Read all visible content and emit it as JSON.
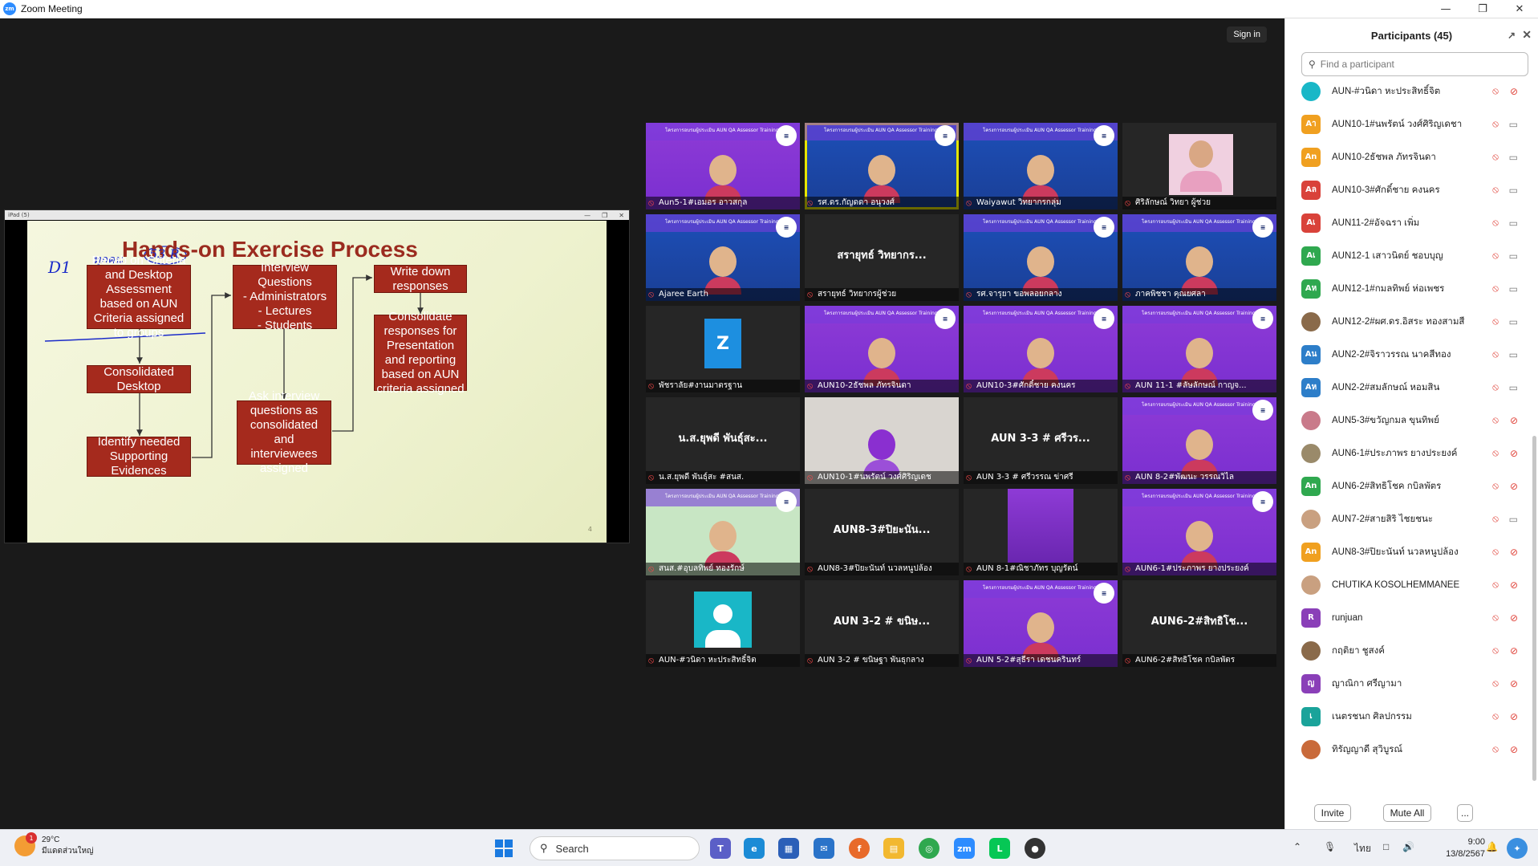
{
  "window": {
    "title": "Zoom Meeting",
    "logo": "zm"
  },
  "header": {
    "signin_label": "Sign in"
  },
  "share": {
    "window_title": "iPad (5)",
    "slide_title": "Hands-on Exercise Process",
    "boxes": [
      "Recab on Criteria and Desktop Assessment based on  AUN Criteria assigned to groups",
      "Interview Questions\n- Administrators\n-    Lectures\n-    Students",
      "Write down responses",
      "Consolidated Desktop",
      "Consolidate responses for Presentation and reporting based on AUN criteria assigned",
      "Ask interview questions as consolidated and interviewees assigned",
      "Identify needed Supporting Evidences"
    ],
    "ink_notes": {
      "d1": "D1",
      "group": "ทุกคน",
      "room": "53 R"
    },
    "page_number": "4"
  },
  "video_tiles": [
    {
      "label": "Aun5-1#เอมอร อาวสกุล",
      "style": "purple",
      "banner": "โครงการอบรมผู้ประเมิน AUN QA Assessor Training"
    },
    {
      "label": "รศ.ดร.กัญดดา อนุวงศ์",
      "style": "blue",
      "active": true,
      "banner": "โครงการอบรมผู้ประเมิน AUN QA Assessor Training"
    },
    {
      "label": "Waiyawut วิทยากรกลุ่ม",
      "style": "blue",
      "banner": "โครงการอบรมผู้ประเมิน AUN QA Assessor Training"
    },
    {
      "label": "ศิริลักษณ์ วิทยา ผู้ช่วย",
      "style": "dark"
    },
    {
      "label": "Ajaree  Earth",
      "style": "blue",
      "banner": "โครงการอบรมผู้ประเมิน AUN QA Assessor Training"
    },
    {
      "label": "สรายุทธ์ วิทยากรผู้ช่วย",
      "style": "name",
      "name": "สรายุทธ์ วิทยากร..."
    },
    {
      "label": "รศ.จารุยา ขอพลอยกลาง",
      "style": "blue",
      "banner": "โครงการอบรมผู้ประเมิน AUN QA Assessor Training"
    },
    {
      "label": "ภาคพิชชา คุณยศลา",
      "style": "blue",
      "banner": "โครงการอบรมผู้ประเมิน AUN QA Assessor Training"
    },
    {
      "label": "พัชราลัย#งานมาตรฐาน",
      "style": "avatar-z",
      "avatar": "Z"
    },
    {
      "label": "AUN10-2ธัชพล ภัทรจินดา",
      "style": "purple",
      "banner": "โครงการอบรมผู้ประเมิน AUN QA Assessor Training"
    },
    {
      "label": "AUN10-3#ศักดิ์ชาย คงนคร",
      "style": "purple",
      "banner": "โครงการอบรมผู้ประเมิน AUN QA Assessor Training"
    },
    {
      "label": "AUN 11-1 #ลัษลักษณ์ กาญจ...",
      "style": "purple",
      "banner": "โครงการอบรมผู้ประเมิน AUN QA Assessor Training"
    },
    {
      "label": "น.ส.ยุพดี พันธุ์สะ #สนส.",
      "style": "name",
      "name": "น.ส.ยุพดี พันธุ์สะ..."
    },
    {
      "label": "AUN10-1#นพรัตน์ วงศ์ศิริญเดช",
      "style": "light"
    },
    {
      "label": "AUN 3-3 # ศรีวรรณ ข่าศรี",
      "style": "name",
      "name": "AUN 3-3 # ศรีวร..."
    },
    {
      "label": "AUN 8-2#พัฒนะ วรรณวิไล",
      "style": "purple",
      "banner": "โครงการอบรมผู้ประเมิน AUN QA Assessor Training"
    },
    {
      "label": "สนส.#อุบลทิพย์ ทองรักษ์",
      "style": "green",
      "banner": "โครงการอบรมผู้ประเมิน AUN QA Assessor Training"
    },
    {
      "label": "AUN8-3#ปิยะนันท์ นวลหนูปล้อง",
      "style": "name",
      "name": "AUN8-3#ปิยะนัน..."
    },
    {
      "label": "AUN 8-1#ณิชาภัทร บุญรัตน์",
      "style": "dark-purple"
    },
    {
      "label": "AUN6-1#ประภาพร ยางประยงค์",
      "style": "purple",
      "banner": "โครงการอบรมผู้ประเมิน AUN QA Assessor Training"
    },
    {
      "label": "AUN-#วนิดา หะประสิทธิ์จิต",
      "style": "avatar-person"
    },
    {
      "label": "AUN 3-2 # ขนิษฐา พันธุกลาง",
      "style": "name",
      "name": "AUN 3-2 # ขนิษ..."
    },
    {
      "label": "AUN 5-2#สุธีรา เดชนครินทร์",
      "style": "purple",
      "banner": "โครงการอบรมผู้ประเมิน AUN QA Assessor Training"
    },
    {
      "label": "AUN6-2#สิทธิโชค กบิลพัตร",
      "style": "name",
      "name": "AUN6-2#สิทธิโช..."
    }
  ],
  "participants": {
    "title": "Participants (45)",
    "search_placeholder": "Find a participant",
    "list": [
      {
        "initials": "",
        "name": "AUN-#วนิดา หะประสิทธิ์จิต",
        "color": "#19b7c7",
        "camera": "off"
      },
      {
        "initials": "Aา",
        "name": "AUN10-1#นพรัตน์ วงศ์ศิริญเดชา",
        "color": "#f0a020",
        "camera": "on"
      },
      {
        "initials": "An",
        "name": "AUN10-2ธัชพล ภัทรจินดา",
        "color": "#f0a020",
        "camera": "on"
      },
      {
        "initials": "Aล",
        "name": "AUN10-3#ศักดิ์ชาย คงนคร",
        "color": "#d9423a",
        "camera": "on"
      },
      {
        "initials": "Aเ",
        "name": "AUN11-2#อัจฉรา เพิ่ม",
        "color": "#d9423a",
        "camera": "on"
      },
      {
        "initials": "Aเ",
        "name": "AUN12-1 เสาวนิตย์ ชอบบุญ",
        "color": "#2fa84f",
        "camera": "on"
      },
      {
        "initials": "Aห",
        "name": "AUN12-1#กมลทิพย์ ห่อเพชร",
        "color": "#2fa84f",
        "camera": "on"
      },
      {
        "initials": "",
        "name": "AUN12-2#ผศ.ดร.อิสระ ทองสามสี",
        "color": "#8a6a4a",
        "camera": "on"
      },
      {
        "initials": "Aน",
        "name": "AUN2-2#จิราวรรณ นาคสีทอง",
        "color": "#2d7ec9",
        "camera": "on"
      },
      {
        "initials": "Aห",
        "name": "AUN2-2#สมลักษณ์ หอมสิน",
        "color": "#2d7ec9",
        "camera": "on"
      },
      {
        "initials": "",
        "name": "AUN5-3#ขวัญกมล ขุนทิพย์",
        "color": "#c97a8a",
        "camera": "off"
      },
      {
        "initials": "",
        "name": "AUN6-1#ประภาพร ยางประยงค์",
        "color": "#9a8a6a",
        "camera": "off"
      },
      {
        "initials": "An",
        "name": "AUN6-2#สิทธิโชค กบิลพัตร",
        "color": "#2fa84f",
        "camera": "off"
      },
      {
        "initials": "",
        "name": "AUN7-2#สายสิริ ไชยชนะ",
        "color": "#c9a080",
        "camera": "on"
      },
      {
        "initials": "An",
        "name": "AUN8-3#ปิยะนันท์ นวลหนูปล้อง",
        "color": "#f0a020",
        "camera": "off"
      },
      {
        "initials": "",
        "name": "CHUTIKA KOSOLHEMMANEE",
        "color": "#c9a080",
        "camera": "off"
      },
      {
        "initials": "R",
        "name": "runjuan",
        "color": "#8a3fb8",
        "camera": "off"
      },
      {
        "initials": "",
        "name": "กฤติยา ชูสงค์",
        "color": "#8a6a4a",
        "camera": "off"
      },
      {
        "initials": "ญ",
        "name": "ญาณิกา ศรีญามา",
        "color": "#8a3fb8",
        "camera": "off"
      },
      {
        "initials": "เ",
        "name": "เนตรชนก ศิลปกรรม",
        "color": "#1aa39a",
        "camera": "off"
      },
      {
        "initials": "",
        "name": "ทิรัญญาดี สุวิบูรณ์",
        "color": "#c96a3a",
        "camera": "off"
      }
    ],
    "invite_label": "Invite",
    "mute_all_label": "Mute All",
    "more_label": "..."
  },
  "taskbar": {
    "temperature": "29°C",
    "weather_desc": "มีแดดส่วนใหญ่",
    "weather_badge": "1",
    "search_label": "Search",
    "language": "ไทย",
    "time": "9:00",
    "date": "13/8/2567",
    "zoom_icon_text": "zm"
  }
}
